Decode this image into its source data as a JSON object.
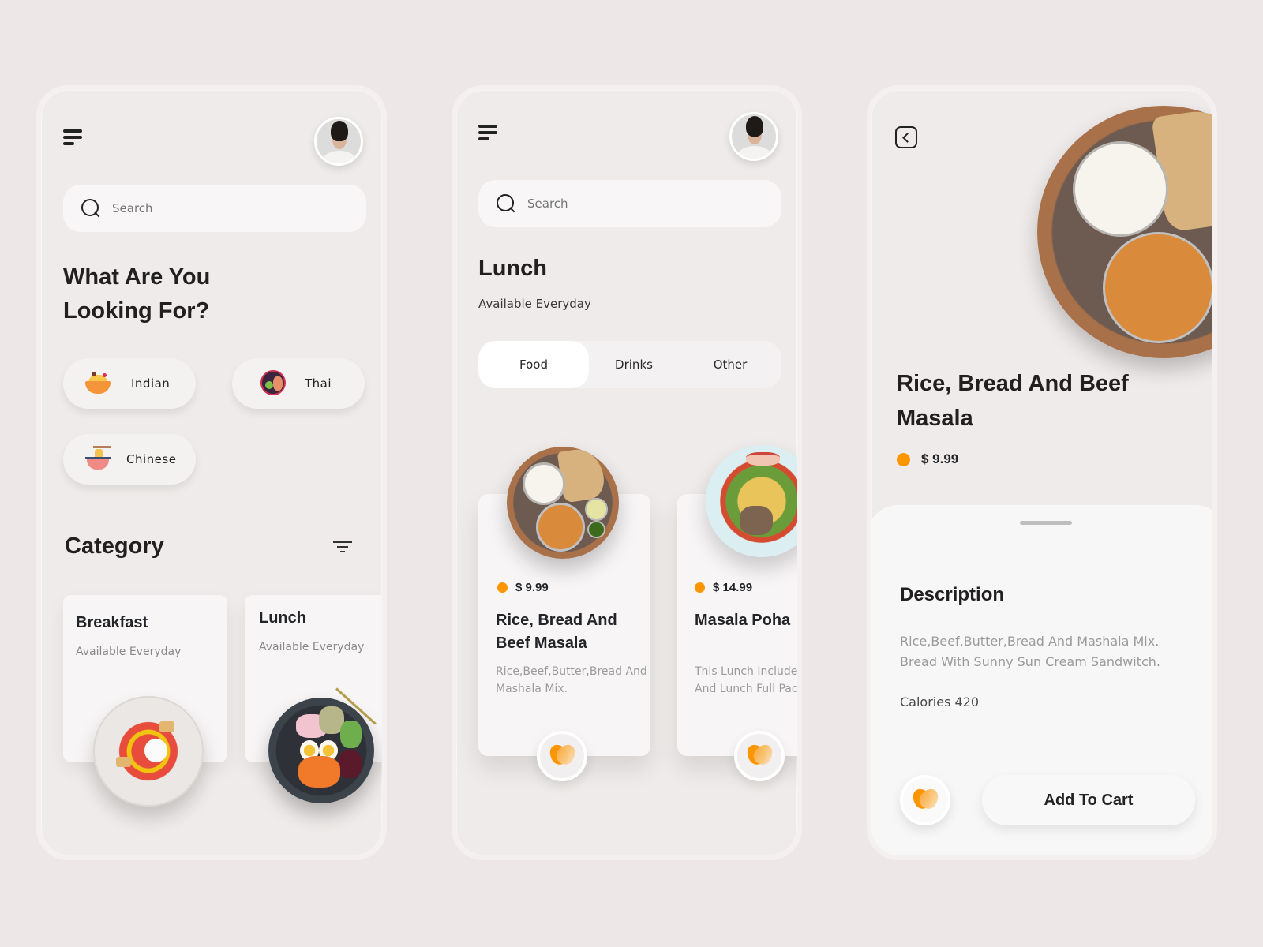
{
  "screen1": {
    "search": {
      "placeholder": "Search"
    },
    "headline_line1": "What Are You",
    "headline_line2": "Looking For?",
    "cuisines": [
      {
        "label": "Indian",
        "icon": "indian-bowl-icon"
      },
      {
        "label": "Thai",
        "icon": "thai-plate-icon"
      },
      {
        "label": "Chinese",
        "icon": "noodle-bowl-icon"
      }
    ],
    "category_title": "Category",
    "categories": [
      {
        "title": "Breakfast",
        "subtitle": "Available Everyday",
        "image": "salad-bowl"
      },
      {
        "title": "Lunch",
        "subtitle": "Available Everyday",
        "image": "poke-bowl"
      }
    ]
  },
  "screen2": {
    "search": {
      "placeholder": "Search"
    },
    "title": "Lunch",
    "subtitle": "Available Everyday",
    "tabs": [
      {
        "label": "Food",
        "active": true
      },
      {
        "label": "Drinks",
        "active": false
      },
      {
        "label": "Other",
        "active": false
      }
    ],
    "items": [
      {
        "price": "$ 9.99",
        "title_line1": "Rice, Bread And",
        "title_line2": "Beef Masala",
        "desc_line1": "Rice,Beef,Butter,Bread And",
        "desc_line2": "Mashala Mix.",
        "image": "thali-plate"
      },
      {
        "price": "$ 14.99",
        "title_line1": "Masala Poha",
        "title_line2": "",
        "desc_line1": "This Lunch Included",
        "desc_line2": "And Lunch Full Pack",
        "image": "pasta-bowl"
      }
    ]
  },
  "screen3": {
    "title_line1": "Rice, Bread And Beef",
    "title_line2": "Masala",
    "price": "$ 9.99",
    "description_heading": "Description",
    "description_line1": "Rice,Beef,Butter,Bread And Mashala Mix.",
    "description_line2": "Bread With Sunny Sun Cream Sandwitch.",
    "calories": "Calories 420",
    "add_to_cart": "Add To Cart"
  },
  "colors": {
    "background": "#ede8e7",
    "accent_orange": "#fb9500",
    "text_dark": "#211f1f",
    "text_muted": "#9c9a9a"
  }
}
